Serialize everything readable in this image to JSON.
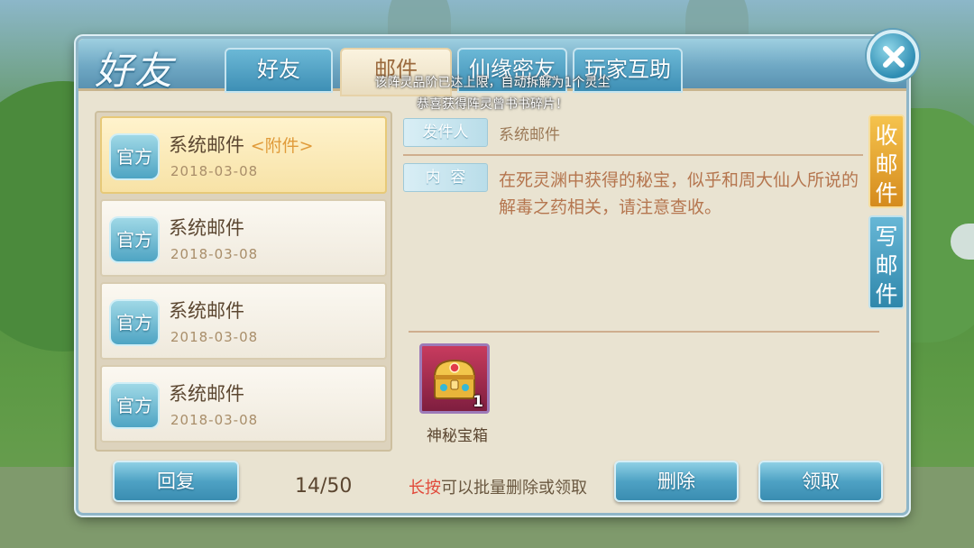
{
  "panel": {
    "title": "好友"
  },
  "tabs": [
    {
      "label": "好友"
    },
    {
      "label": "邮件"
    },
    {
      "label": "仙缘密友"
    },
    {
      "label": "玩家互助"
    }
  ],
  "notices": [
    "该阵灵品阶已达上限，自动拆解为1个灵尘",
    "恭喜获得阵灵曾书书碎片！"
  ],
  "mails": [
    {
      "badge": "官方",
      "subject": "系统邮件",
      "attachment": "<附件>",
      "date": "2018-03-08"
    },
    {
      "badge": "官方",
      "subject": "系统邮件",
      "attachment": "",
      "date": "2018-03-08"
    },
    {
      "badge": "官方",
      "subject": "系统邮件",
      "attachment": "",
      "date": "2018-03-08"
    },
    {
      "badge": "官方",
      "subject": "系统邮件",
      "attachment": "",
      "date": "2018-03-08"
    }
  ],
  "detail": {
    "sender_label": "发件人",
    "sender_value": "系统邮件",
    "content_label": "内  容",
    "content_text": "在死灵渊中获得的秘宝，似乎和周大仙人所说的解毒之药相关，请注意查收。",
    "item": {
      "name": "神秘宝箱",
      "count": "1",
      "icon": "treasure-chest-icon"
    }
  },
  "side_tabs": {
    "inbox": "收邮件",
    "compose": "写邮件"
  },
  "footer": {
    "reply": "回复",
    "page_count": "14/50",
    "hint_strong": "长按",
    "hint_rest": "可以批量删除或领取",
    "delete": "删除",
    "claim": "领取"
  },
  "colors": {
    "accent_blue": "#4ea2c4",
    "gold_tab": "#f5c34d",
    "hint_red": "#e14a3b",
    "panel_bg": "#e9e3d1"
  }
}
